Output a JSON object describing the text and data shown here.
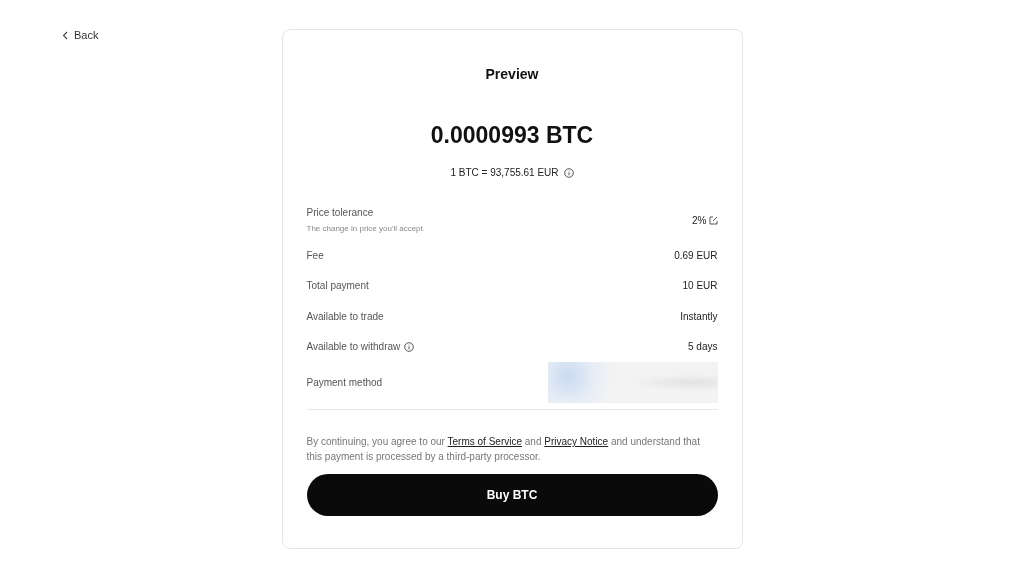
{
  "back": {
    "label": "Back"
  },
  "card": {
    "title": "Preview",
    "amount": "0.0000993 BTC",
    "rate": "1 BTC = 93,755.61 EUR",
    "rows": [
      {
        "kind": "editable",
        "label": "Price tolerance",
        "hint": "The change in price you'll accept.",
        "value": "2%"
      },
      {
        "kind": "plain",
        "label": "Fee",
        "value": "0.69 EUR"
      },
      {
        "kind": "plain",
        "label": "Total payment",
        "value": "10 EUR"
      },
      {
        "kind": "plain",
        "label": "Available to trade",
        "value": "Instantly"
      },
      {
        "kind": "info",
        "label": "Available to withdraw",
        "value": "5 days"
      },
      {
        "kind": "hidden",
        "label": "Payment method"
      }
    ],
    "terms": {
      "before": "By continuing, you agree to our",
      "link1": "Terms of Service",
      "middle": "and",
      "link2": "Privacy Notice",
      "after": "and understand that this payment is processed by a third-party processor."
    },
    "button": "Buy BTC"
  }
}
